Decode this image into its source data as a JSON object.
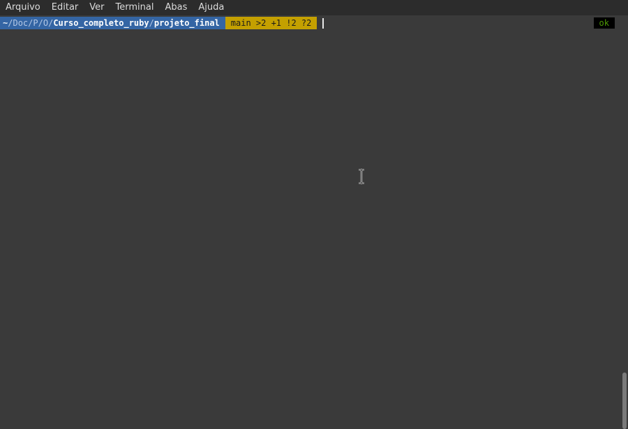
{
  "menubar": {
    "items": [
      "Arquivo",
      "Editar",
      "Ver",
      "Terminal",
      "Abas",
      "Ajuda"
    ]
  },
  "prompt": {
    "path_parts": {
      "home": "~",
      "sep": "/",
      "doc": "Doc",
      "p": "P",
      "o": "O",
      "project": "Curso_completo_ruby",
      "folder": "projeto_final"
    },
    "git_status": "main >2 +1 !2 ?2"
  },
  "status": {
    "label": "ok"
  },
  "colors": {
    "path_bg": "#3465a4",
    "git_bg": "#c4a000",
    "ok_fg": "#4e9a06",
    "terminal_bg": "#3a3a3a"
  },
  "icons": {
    "pointer": "i-beam-cursor-icon"
  }
}
